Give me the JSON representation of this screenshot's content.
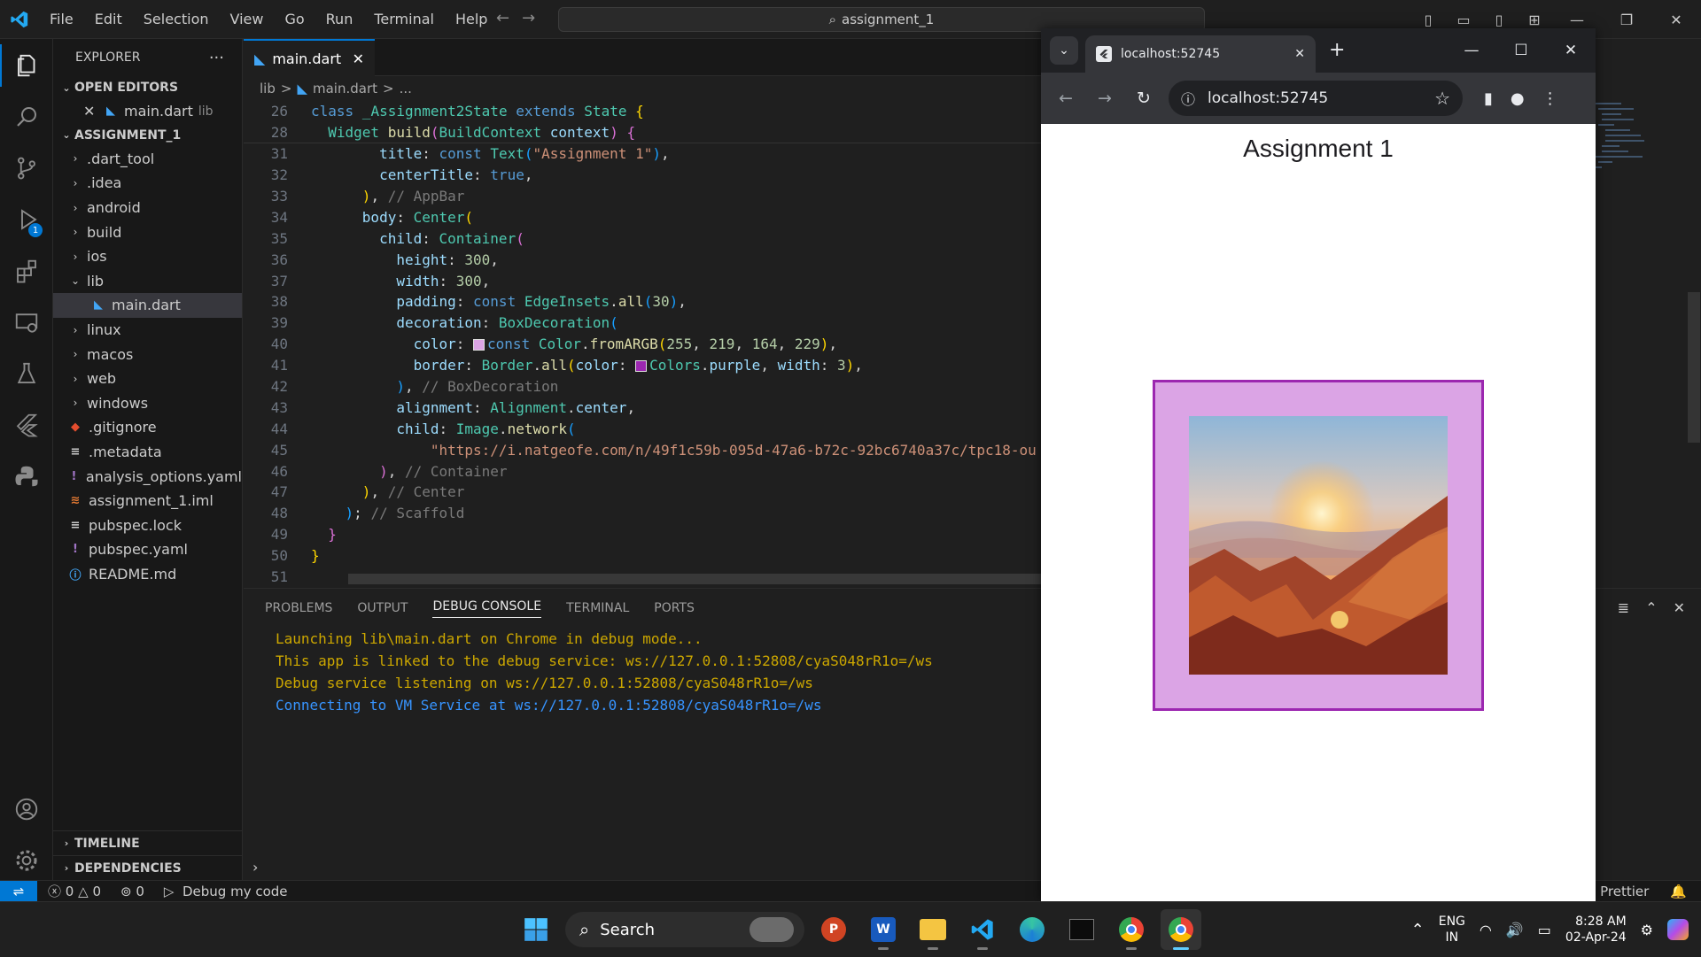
{
  "titlebar": {
    "menu": [
      "File",
      "Edit",
      "Selection",
      "View",
      "Go",
      "Run",
      "Terminal",
      "Help"
    ],
    "search": "assignment_1"
  },
  "activity": {
    "debug_badge": "1"
  },
  "explorer": {
    "title": "EXPLORER",
    "open_editors": "OPEN EDITORS",
    "open_file": "main.dart",
    "open_file_dir": "lib",
    "project": "ASSIGNMENT_1",
    "tree": [
      {
        "name": ".dart_tool",
        "type": "folder",
        "indent": 0
      },
      {
        "name": ".idea",
        "type": "folder",
        "indent": 0
      },
      {
        "name": "android",
        "type": "folder",
        "indent": 0
      },
      {
        "name": "build",
        "type": "folder",
        "indent": 0
      },
      {
        "name": "ios",
        "type": "folder",
        "indent": 0
      },
      {
        "name": "lib",
        "type": "folder-open",
        "indent": 0
      },
      {
        "name": "main.dart",
        "type": "dart",
        "indent": 1,
        "selected": true
      },
      {
        "name": "linux",
        "type": "folder",
        "indent": 0
      },
      {
        "name": "macos",
        "type": "folder",
        "indent": 0
      },
      {
        "name": "web",
        "type": "folder",
        "indent": 0
      },
      {
        "name": "windows",
        "type": "folder",
        "indent": 0
      },
      {
        "name": ".gitignore",
        "type": "git",
        "indent": 0
      },
      {
        "name": ".metadata",
        "type": "text",
        "indent": 0
      },
      {
        "name": "analysis_options.yaml",
        "type": "yaml",
        "indent": 0
      },
      {
        "name": "assignment_1.iml",
        "type": "iml",
        "indent": 0
      },
      {
        "name": "pubspec.lock",
        "type": "text",
        "indent": 0
      },
      {
        "name": "pubspec.yaml",
        "type": "yaml",
        "indent": 0
      },
      {
        "name": "README.md",
        "type": "info",
        "indent": 0
      }
    ],
    "timeline": "TIMELINE",
    "dependencies": "DEPENDENCIES"
  },
  "editor": {
    "tab": "main.dart",
    "breadcrumb": [
      "lib",
      ">",
      "main.dart",
      ">",
      "..."
    ],
    "code": [
      {
        "n": "26",
        "html": "<span class='kw'>class</span> <span class='ty'>_Assignment2State</span> <span class='kw'>extends</span> <span class='ty'>State</span> <span class='br1'>{</span>"
      },
      {
        "n": "28",
        "html": "  <span class='ty'>Widget</span> <span class='fn'>build</span><span class='br2'>(</span><span class='ty'>BuildContext</span> <span class='pr'>context</span><span class='br2'>)</span> <span class='br2'>{</span>"
      },
      {
        "n": "31",
        "html": "        <span class='pr'>title</span><span class='pl'>: </span><span class='kw'>const</span> <span class='ty'>Text</span><span class='br3'>(</span><span class='st'>\"Assignment 1\"</span><span class='br3'>)</span><span class='pl'>,</span>"
      },
      {
        "n": "32",
        "html": "        <span class='pr'>centerTitle</span><span class='pl'>: </span><span class='kw'>true</span><span class='pl'>,</span>"
      },
      {
        "n": "33",
        "html": "      <span class='br1'>)</span><span class='pl'>, </span><span class='cm'>// AppBar</span>"
      },
      {
        "n": "34",
        "html": "      <span class='pr'>body</span><span class='pl'>: </span><span class='ty'>Center</span><span class='br1'>(</span>"
      },
      {
        "n": "35",
        "html": "        <span class='pr'>child</span><span class='pl'>: </span><span class='ty'>Container</span><span class='br2'>(</span>"
      },
      {
        "n": "36",
        "html": "          <span class='pr'>height</span><span class='pl'>: </span><span class='nm'>300</span><span class='pl'>,</span>"
      },
      {
        "n": "37",
        "html": "          <span class='pr'>width</span><span class='pl'>: </span><span class='nm'>300</span><span class='pl'>,</span>"
      },
      {
        "n": "38",
        "html": "          <span class='pr'>padding</span><span class='pl'>: </span><span class='kw'>const</span> <span class='ty'>EdgeInsets</span><span class='pl'>.</span><span class='fn'>all</span><span class='br3'>(</span><span class='nm'>30</span><span class='br3'>)</span><span class='pl'>,</span>"
      },
      {
        "n": "39",
        "html": "          <span class='pr'>decoration</span><span class='pl'>: </span><span class='ty'>BoxDecoration</span><span class='br3'>(</span>"
      },
      {
        "n": "40",
        "html": "            <span class='pr'>color</span><span class='pl'>: </span><span class='sw' style='background:#dba4e5'></span><span class='kw'>const</span> <span class='ty'>Color</span><span class='pl'>.</span><span class='fn'>fromARGB</span><span class='br1'>(</span><span class='nm'>255</span><span class='pl'>, </span><span class='nm'>219</span><span class='pl'>, </span><span class='nm'>164</span><span class='pl'>, </span><span class='nm'>229</span><span class='br1'>)</span><span class='pl'>,</span>"
      },
      {
        "n": "41",
        "html": "            <span class='pr'>border</span><span class='pl'>: </span><span class='ty'>Border</span><span class='pl'>.</span><span class='fn'>all</span><span class='br1'>(</span><span class='pr'>color</span><span class='pl'>: </span><span class='sw' style='background:#9c27b0'></span><span class='ty'>Colors</span><span class='pl'>.</span><span class='pr'>purple</span><span class='pl'>, </span><span class='pr'>width</span><span class='pl'>: </span><span class='nm'>3</span><span class='br1'>)</span><span class='pl'>,</span>"
      },
      {
        "n": "42",
        "html": "          <span class='br3'>)</span><span class='pl'>, </span><span class='cm'>// BoxDecoration</span>"
      },
      {
        "n": "43",
        "html": "          <span class='pr'>alignment</span><span class='pl'>: </span><span class='ty'>Alignment</span><span class='pl'>.</span><span class='pr'>center</span><span class='pl'>,</span>"
      },
      {
        "n": "44",
        "html": "          <span class='pr'>child</span><span class='pl'>: </span><span class='ty'>Image</span><span class='pl'>.</span><span class='fn'>network</span><span class='br3'>(</span>"
      },
      {
        "n": "45",
        "html": "              <span class='st'>\"https://i.natgeofe.com/n/49f1c59b-095d-47a6-b72c-92bc6740a37c/tpc18-ou</span>"
      },
      {
        "n": "46",
        "html": "        <span class='br2'>)</span><span class='pl'>, </span><span class='cm'>// Container</span>"
      },
      {
        "n": "47",
        "html": "      <span class='br1'>)</span><span class='pl'>, </span><span class='cm'>// Center</span>"
      },
      {
        "n": "48",
        "html": "    <span class='br3'>)</span><span class='pl'>; </span><span class='cm'>// Scaffold</span>"
      },
      {
        "n": "49",
        "html": "  <span class='br2'>}</span>"
      },
      {
        "n": "50",
        "html": "<span class='br1'>}</span>"
      },
      {
        "n": "51",
        "html": ""
      }
    ]
  },
  "panel": {
    "tabs": [
      "PROBLEMS",
      "OUTPUT",
      "DEBUG CONSOLE",
      "TERMINAL",
      "PORTS"
    ],
    "active": "DEBUG CONSOLE",
    "lines": [
      {
        "text": "Launching lib\\main.dart on Chrome in debug mode...",
        "color": "y"
      },
      {
        "text": "This app is linked to the debug service: ws://127.0.0.1:52808/cyaS048rR1o=/ws",
        "color": "y"
      },
      {
        "text": "Debug service listening on ws://127.0.0.1:52808/cyaS048rR1o=/ws",
        "color": "y"
      },
      {
        "text": "Connecting to VM Service at ws://127.0.0.1:52808/cyaS048rR1o=/ws",
        "color": "b"
      }
    ]
  },
  "status": {
    "errors": "0",
    "warnings": "0",
    "ports": "0",
    "debug": "Debug my code",
    "prettier": "Prettier"
  },
  "browser": {
    "tab_title": "localhost:52745",
    "url": "localhost:52745",
    "app_title": "Assignment 1"
  },
  "taskbar": {
    "search": "Search",
    "lang1": "ENG",
    "lang2": "IN",
    "time": "8:28 AM",
    "date": "02-Apr-24"
  }
}
